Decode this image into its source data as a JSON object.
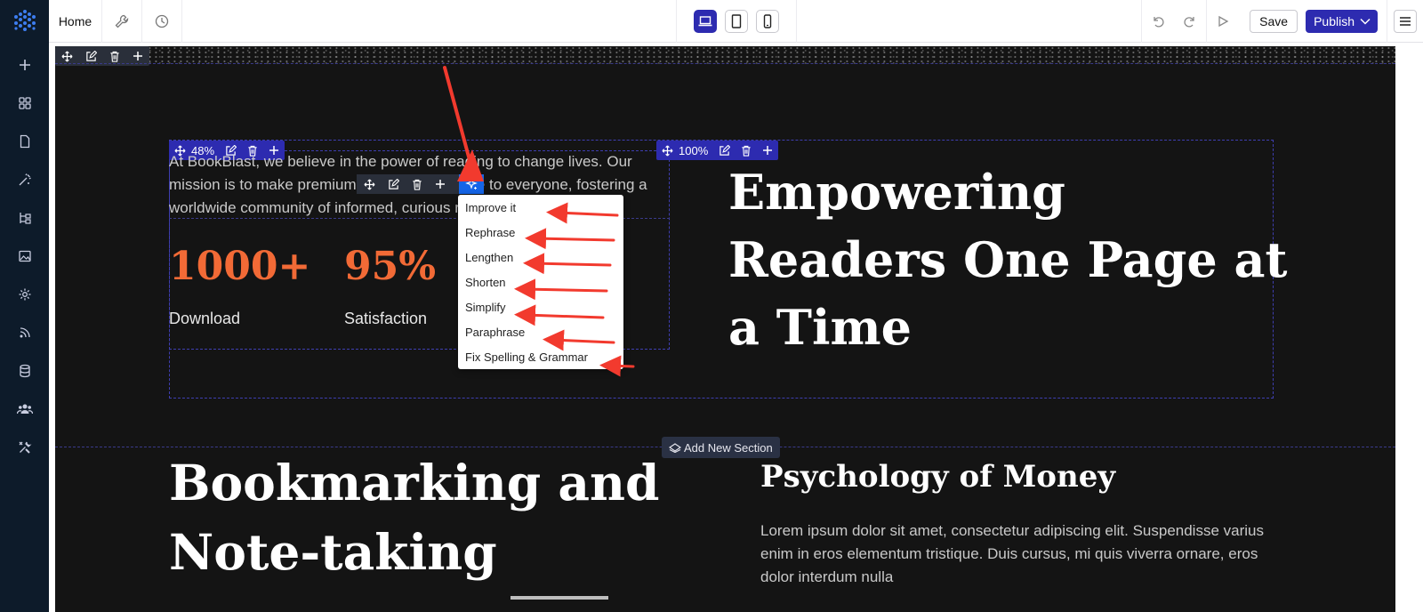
{
  "topbar": {
    "home_label": "Home",
    "save_label": "Save",
    "publish_label": "Publish"
  },
  "colors": {
    "brand": "#2d2bb0",
    "canvas_bg": "#141414",
    "accent_orange": "#f26a36",
    "ai_blue": "#1565e8",
    "annotation_red": "#f23a2e"
  },
  "sidebar_icons": [
    "plus-icon",
    "grid-icon",
    "page-icon",
    "magic-icon",
    "tree-icon",
    "image-icon",
    "gear-icon",
    "feed-icon",
    "database-icon",
    "users-icon",
    "tools-icon"
  ],
  "section1": {
    "column_width_label": "48%",
    "heading_width_label": "100%",
    "paragraph": "At BookBlast, we believe in the power of reading to change lives. Our mission is to make premium content accessible to everyone, fostering a worldwide community of informed, curious readers.",
    "stats": [
      {
        "value": "1000+",
        "label": "Download"
      },
      {
        "value": "95%",
        "label": "Satisfaction"
      }
    ],
    "heading": "Empowering Readers One Page at a Time"
  },
  "ai_menu": {
    "items": [
      "Improve it",
      "Rephrase",
      "Lengthen",
      "Shorten",
      "Simplify",
      "Paraphrase",
      "Fix Spelling & Grammar"
    ]
  },
  "add_section_label": "Add New Section",
  "section2": {
    "heading": "Bookmarking and Note-taking",
    "subheading": "Psychology of Money",
    "body": "Lorem ipsum dolor sit amet, consectetur adipiscing elit. Suspendisse varius enim in eros elementum tristique. Duis cursus, mi quis viverra ornare, eros dolor interdum nulla"
  }
}
